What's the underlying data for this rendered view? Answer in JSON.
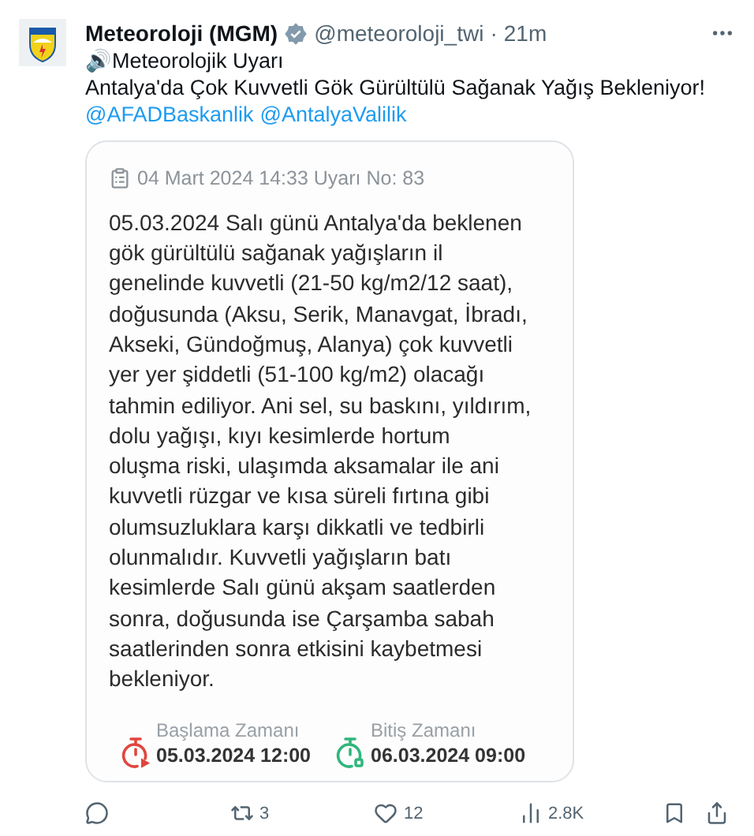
{
  "tweet": {
    "name": "Meteoroloji (MGM)",
    "verified": true,
    "handle": "@meteoroloji_twi",
    "separator": "·",
    "time": "21m",
    "lines": [
      "🔊Meteorolojik Uyarı",
      "Antalya'da Çok Kuvvetli Gök Gürültülü Sağanak Yağış Bekleniyor!"
    ],
    "mentions": [
      "@AFADBaskanlik",
      "@AntalyaValilik"
    ]
  },
  "card": {
    "header": "04 Mart 2024 14:33 Uyarı No: 83",
    "body_lines": [
      "05.03.2024 Salı günü Antalya'da beklenen",
      "gök gürültülü sağanak yağışların il",
      "genelinde kuvvetli (21-50 kg/m2/12 saat),",
      "doğusunda (Aksu, Serik, Manavgat, İbradı,",
      "Akseki, Gündoğmuş, Alanya) çok kuvvetli",
      "yer yer şiddetli (51-100 kg/m2) olacağı",
      "tahmin ediliyor. Ani sel, su baskını, yıldırım,",
      "dolu yağışı, kıyı kesimlerde hortum",
      "oluşma riski, ulaşımda aksamalar ile ani",
      "kuvvetli rüzgar ve kısa süreli fırtına gibi",
      "olumsuzluklara karşı dikkatli ve tedbirli",
      "olunmalıdır. Kuvvetli yağışların batı",
      "kesimlerde Salı günü akşam saatlerden",
      "sonra, doğusunda ise Çarşamba sabah",
      "saatlerinden sonra etkisini kaybetmesi",
      "bekleniyor."
    ],
    "times": [
      {
        "kind": "start",
        "label": "Başlama Zamanı",
        "value": "05.03.2024 12:00",
        "color": "#e0463f"
      },
      {
        "kind": "end",
        "label": "Bitiş Zamanı",
        "value": "06.03.2024 09:00",
        "color": "#2fb67c"
      }
    ]
  },
  "actions": [
    {
      "kind": "reply"
    },
    {
      "kind": "retweet",
      "count": "3"
    },
    {
      "kind": "like",
      "count": "12"
    },
    {
      "kind": "views",
      "count": "2.8K"
    }
  ]
}
